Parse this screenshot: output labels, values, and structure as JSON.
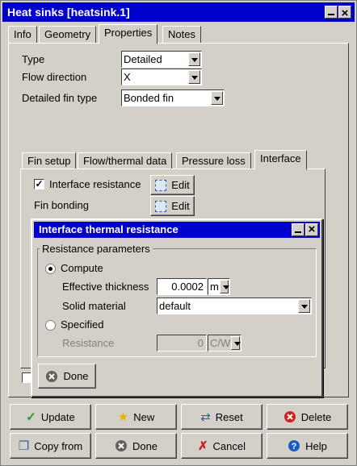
{
  "window": {
    "title": "Heat sinks [heatsink.1]"
  },
  "tabs": [
    {
      "label": "Info"
    },
    {
      "label": "Geometry"
    },
    {
      "label": "Properties"
    },
    {
      "label": "Notes"
    }
  ],
  "properties": {
    "type_label": "Type",
    "type_value": "Detailed",
    "flow_label": "Flow direction",
    "flow_value": "X",
    "fin_label": "Detailed fin type",
    "fin_value": "Bonded fin"
  },
  "subtabs": [
    {
      "label": "Fin setup"
    },
    {
      "label": "Flow/thermal data"
    },
    {
      "label": "Pressure loss"
    },
    {
      "label": "Interface"
    }
  ],
  "interface": {
    "resistance_label": "Interface resistance",
    "resistance_checked": true,
    "edit_label": "Edit",
    "bonding_label": "Fin bonding"
  },
  "dialog": {
    "title": "Interface thermal resistance",
    "group_label": "Resistance parameters",
    "compute_label": "Compute",
    "thickness_label": "Effective thickness",
    "thickness_value": "0.0002",
    "thickness_unit": "m",
    "material_label": "Solid material",
    "material_value": "default",
    "specified_label": "Specified",
    "resistance_label": "Resistance",
    "resistance_value": "0",
    "resistance_unit": "C/W",
    "done_label": "Done"
  },
  "buttons": {
    "update": "Update",
    "new": "New",
    "reset": "Reset",
    "delete": "Delete",
    "copy_from": "Copy from",
    "done": "Done",
    "cancel": "Cancel",
    "help": "Help"
  },
  "colors": {
    "titlebar": "#0000cc",
    "face": "#d4d0c8"
  }
}
